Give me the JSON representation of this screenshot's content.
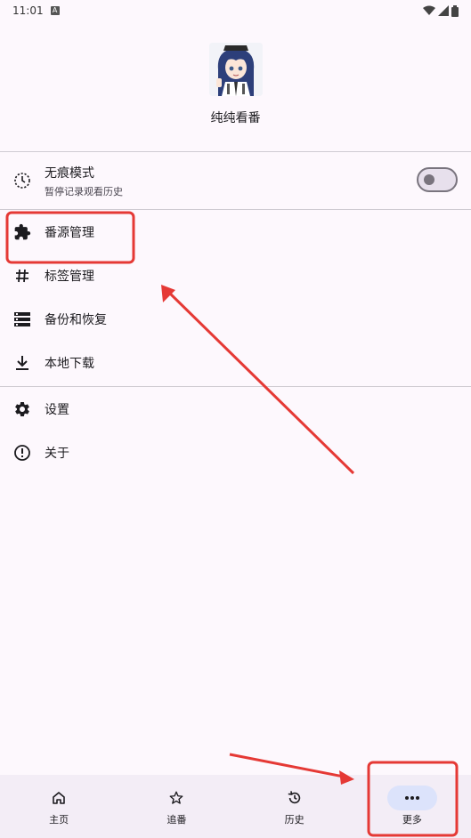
{
  "status_bar": {
    "time": "11:01",
    "notification_icon": "a-icon",
    "right_icons": [
      "wifi-icon",
      "signal-icon",
      "battery-icon"
    ]
  },
  "profile": {
    "avatar": "anime-character-avatar",
    "app_name": "纯纯看番"
  },
  "incognito": {
    "title": "无痕模式",
    "subtitle": "暂停记录观看历史",
    "enabled": false,
    "icon": "history-toggle-icon"
  },
  "menu": {
    "group1": [
      {
        "label": "番源管理",
        "icon": "puzzle-icon"
      },
      {
        "label": "标签管理",
        "icon": "hashtag-icon"
      },
      {
        "label": "备份和恢复",
        "icon": "storage-icon"
      },
      {
        "label": "本地下载",
        "icon": "download-icon"
      }
    ],
    "group2": [
      {
        "label": "设置",
        "icon": "gear-icon"
      },
      {
        "label": "关于",
        "icon": "info-icon"
      }
    ]
  },
  "bottom_nav": [
    {
      "label": "主页",
      "icon": "home-icon",
      "active": false
    },
    {
      "label": "追番",
      "icon": "star-icon",
      "active": false
    },
    {
      "label": "历史",
      "icon": "history-icon",
      "active": false
    },
    {
      "label": "更多",
      "icon": "more-icon",
      "active": true
    }
  ],
  "colors": {
    "background": "#fdf8fd",
    "nav_background": "#f3edf6",
    "active_pill": "#dce3fb",
    "annotation_red": "#e53935"
  }
}
